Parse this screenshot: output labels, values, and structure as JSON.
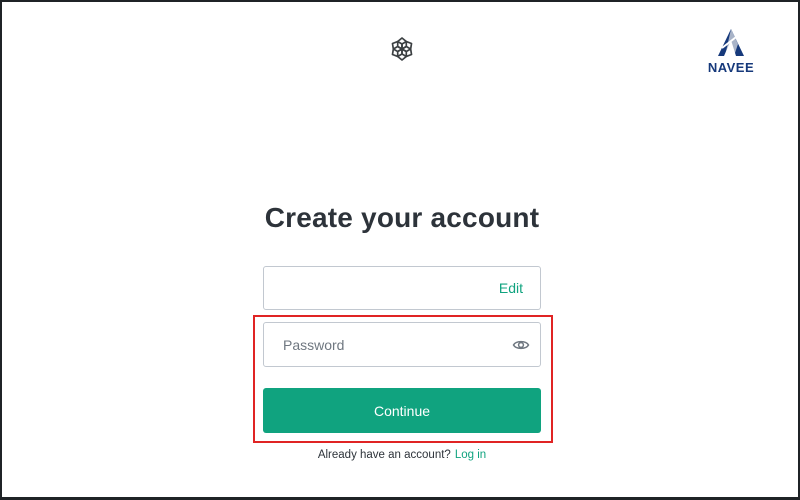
{
  "header": {
    "logo_icon": "openai-logo-icon",
    "brand": {
      "icon": "navee-triangle-logo",
      "name": "NAVEE",
      "color": "#16397b"
    }
  },
  "form": {
    "title": "Create your account",
    "email": {
      "value": "",
      "edit_label": "Edit"
    },
    "password": {
      "placeholder": "Password",
      "visibility_icon": "eye-icon"
    },
    "continue_label": "Continue",
    "footer": {
      "prompt": "Already have an account?",
      "login_label": "Log in"
    }
  },
  "colors": {
    "accent": "#10a37f",
    "highlight": "#e02424",
    "text": "#2d333a",
    "border": "#c2c8d0"
  }
}
